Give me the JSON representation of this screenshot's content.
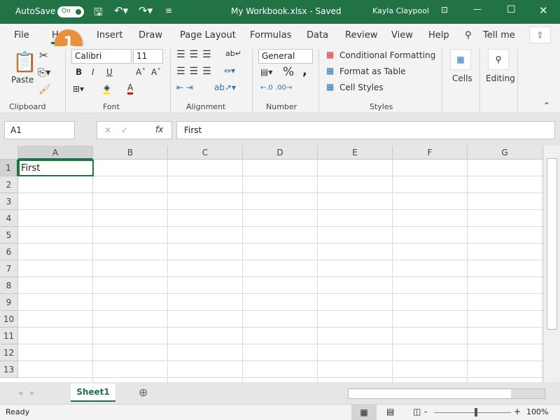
{
  "titlebar": {
    "autosave_label": "AutoSave",
    "autosave_state": "On",
    "title": "My Workbook.xlsx - Saved",
    "user": "Kayla Claypool",
    "accent": "#217346"
  },
  "tabs": [
    "File",
    "Home",
    "Insert",
    "Draw",
    "Page Layout",
    "Formulas",
    "Data",
    "Review",
    "View",
    "Help"
  ],
  "tell_me": "Tell me",
  "callout": "1",
  "ribbon": {
    "clipboard": {
      "paste": "Paste",
      "label": "Clipboard"
    },
    "font": {
      "name": "Calibri",
      "size": "11",
      "bold": "B",
      "italic": "I",
      "underline": "U",
      "label": "Font"
    },
    "alignment": {
      "label": "Alignment"
    },
    "number": {
      "format": "General",
      "percent": "%",
      "comma": ",",
      "label": "Number"
    },
    "styles": {
      "conditional": "Conditional Formatting",
      "table": "Format as Table",
      "cell_styles": "Cell Styles",
      "label": "Styles"
    },
    "cells": {
      "label": "Cells"
    },
    "editing": {
      "label": "Editing"
    }
  },
  "formula_bar": {
    "name_box": "A1",
    "fx": "fx",
    "content": "First"
  },
  "columns": [
    "A",
    "B",
    "C",
    "D",
    "E",
    "F",
    "G"
  ],
  "rows": [
    "1",
    "2",
    "3",
    "4",
    "5",
    "6",
    "7",
    "8",
    "9",
    "10",
    "11",
    "12",
    "13"
  ],
  "cells": {
    "A1": "First"
  },
  "sheets": [
    "Sheet1"
  ],
  "status": {
    "text": "Ready",
    "zoom": "100%"
  }
}
